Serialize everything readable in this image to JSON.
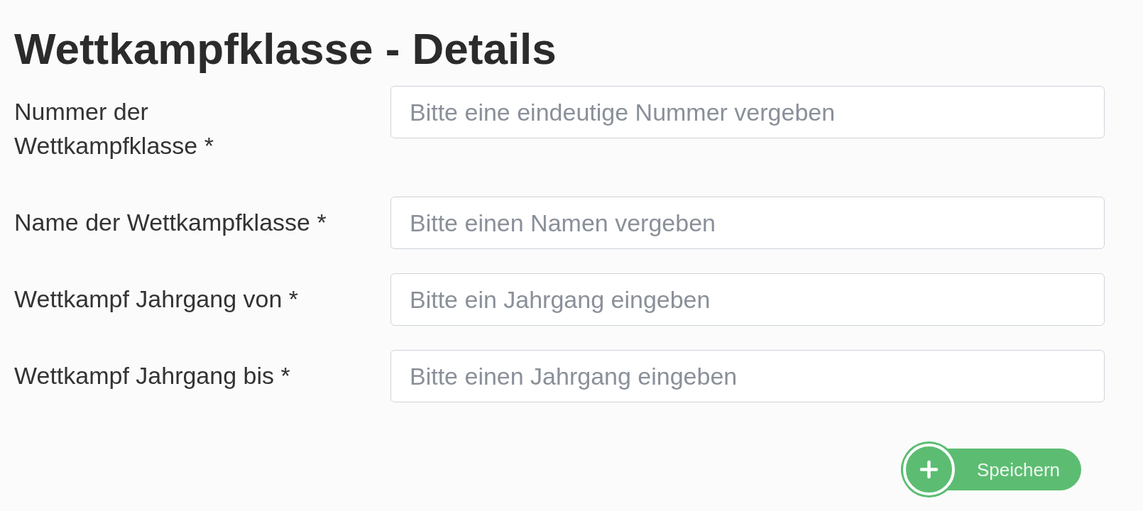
{
  "title": "Wettkampfklasse - Details",
  "fields": [
    {
      "label": "Nummer der Wettkampfklasse *",
      "placeholder": "Bitte eine eindeutige Nummer vergeben"
    },
    {
      "label": "Name der Wettkampfklasse *",
      "placeholder": "Bitte einen Namen vergeben"
    },
    {
      "label": "Wettkampf Jahrgang von *",
      "placeholder": "Bitte ein Jahrgang eingeben"
    },
    {
      "label": "Wettkampf Jahrgang bis *",
      "placeholder": "Bitte einen Jahrgang eingeben"
    }
  ],
  "save_button": {
    "label": "Speichern"
  }
}
